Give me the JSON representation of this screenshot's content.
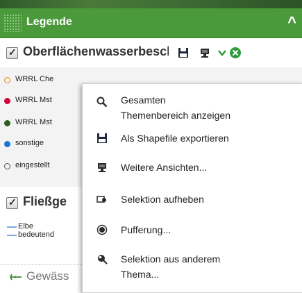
{
  "legend": {
    "title": "Legende"
  },
  "layers": {
    "surface_water": {
      "title": "Oberflächenwasserbescha",
      "legend_items": [
        {
          "label": "WRRL Che",
          "color": "#e08a00"
        },
        {
          "label": "WRRL Mst",
          "color": "#d4003a"
        },
        {
          "label": "WRRL Mst",
          "color": "#2e5e1d"
        },
        {
          "label": "sonstige",
          "color": "#1877d6"
        },
        {
          "label": "eingestellt",
          "color": "#555555"
        }
      ]
    },
    "rivers": {
      "title": "Fließge",
      "line_labels": [
        "Elbe",
        "bedeutend"
      ]
    },
    "waters": {
      "title": "Gewäss"
    }
  },
  "context_menu": {
    "items": [
      {
        "id": "show-all",
        "label_line1": "Gesamten",
        "label_line2": "Themenbereich anzeigen",
        "icon": "search-icon"
      },
      {
        "id": "export-shapefile",
        "label_line1": "Als Shapefile exportieren",
        "icon": "save-icon"
      },
      {
        "id": "more-views",
        "label_line1": "Weitere Ansichten...",
        "icon": "monitor-icon"
      },
      {
        "id": "clear-selection",
        "label_line1": "Selektion aufheben",
        "icon": "clear-selection-icon"
      },
      {
        "id": "buffer",
        "label_line1": "Pufferung...",
        "icon": "buffer-icon"
      },
      {
        "id": "select-from-theme",
        "label_line1": "Selektion aus anderem",
        "label_line2": "Thema...",
        "icon": "theme-select-icon"
      }
    ]
  },
  "colors": {
    "header_green": "#4a9a3c",
    "accent_green": "#2f9a3a",
    "river_blue": "#4a8fd6"
  }
}
